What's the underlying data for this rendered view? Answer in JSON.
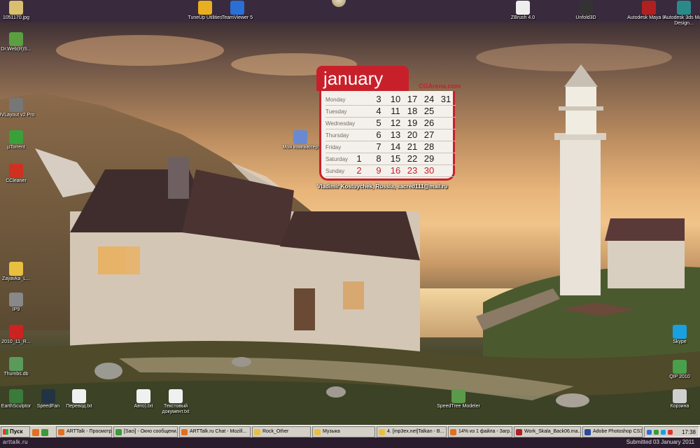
{
  "top_icons": [
    {
      "label": "1051170.jpg",
      "icon": "image-icon",
      "color": "#d8c070"
    },
    {
      "label": "TuneUp Utilities",
      "icon": "tuneup-icon",
      "color": "#e8b020"
    },
    {
      "label": "TeamViewer 5",
      "icon": "teamviewer-icon",
      "color": "#2a6fd6"
    },
    {
      "label": "ZBrush 4.0",
      "icon": "zbrush-icon",
      "color": "#eeeeee"
    },
    {
      "label": "Unfold3D",
      "icon": "unfold3d-icon",
      "color": "#333333"
    },
    {
      "label": "Autodesk Maya 8....",
      "icon": "maya-icon",
      "color": "#b02020"
    },
    {
      "label": "Autodesk 3ds Max Design...",
      "icon": "3dsmax-icon",
      "color": "#2a8a8a"
    }
  ],
  "left_icons": [
    {
      "label": "Dr.Web(R)S...",
      "icon": "drweb-icon",
      "color": "#5aa040"
    },
    {
      "label": "UVLayout v2 Pro",
      "icon": "uvlayout-icon",
      "color": "#777777"
    },
    {
      "label": "µTorrent",
      "icon": "utorrent-icon",
      "color": "#3aa03a"
    },
    {
      "label": "CCleaner",
      "icon": "ccleaner-icon",
      "color": "#d03020"
    },
    {
      "label": "Zayavka_L...",
      "icon": "folder-icon",
      "color": "#e8c040"
    },
    {
      "label": "IP9",
      "icon": "ip9-icon",
      "color": "#888888"
    },
    {
      "label": "2010_11_R...",
      "icon": "pdf-icon",
      "color": "#cc2222"
    },
    {
      "label": "Thumbs.db",
      "icon": "db-file-icon",
      "color": "#5a9a5a"
    }
  ],
  "bottom_icons": [
    {
      "label": "EarthSculptor",
      "icon": "earthsculptor-icon",
      "color": "#3a7a3a"
    },
    {
      "label": "SpeedFan",
      "icon": "speedfan-icon",
      "color": "#223344"
    },
    {
      "label": "Перевод.txt",
      "icon": "txt-file-icon",
      "color": "#f0f0f0"
    },
    {
      "label": "Авто).txt",
      "icon": "txt-file-icon",
      "color": "#f0f0f0"
    },
    {
      "label": "Текстовый документ.txt",
      "icon": "txt-file-icon",
      "color": "#f0f0f0"
    },
    {
      "label": "SpeedTree Modeler",
      "icon": "speedtree-icon",
      "color": "#5a9a4a"
    }
  ],
  "right_icons": [
    {
      "label": "Skype",
      "icon": "skype-icon",
      "color": "#1aa0e0"
    },
    {
      "label": "QIP 2010",
      "icon": "qip-icon",
      "color": "#4aa04a"
    },
    {
      "label": "Корзина",
      "icon": "recycle-bin-icon",
      "color": "#cfcfcf"
    }
  ],
  "center_icon": {
    "label": "Мой компьютер",
    "icon": "my-computer-icon",
    "color": "#6a8ad0"
  },
  "calendar": {
    "month": "january",
    "site": "CGArena.com",
    "author": "Vladimir Kostuychek, Russia, sacred111@mail.ru",
    "rows": [
      {
        "day": "Monday",
        "nums": [
          "",
          "3",
          "10",
          "17",
          "24",
          "31"
        ]
      },
      {
        "day": "Tuesday",
        "nums": [
          "",
          "4",
          "11",
          "18",
          "25",
          ""
        ]
      },
      {
        "day": "Wednesday",
        "nums": [
          "",
          "5",
          "12",
          "19",
          "26",
          ""
        ]
      },
      {
        "day": "Thursday",
        "nums": [
          "",
          "6",
          "13",
          "20",
          "27",
          ""
        ]
      },
      {
        "day": "Friday",
        "nums": [
          "",
          "7",
          "14",
          "21",
          "28",
          ""
        ]
      },
      {
        "day": "Saturday",
        "nums": [
          "1",
          "8",
          "15",
          "22",
          "29",
          ""
        ]
      },
      {
        "day": "Sunday",
        "nums": [
          "2",
          "9",
          "16",
          "23",
          "30",
          ""
        ]
      }
    ]
  },
  "taskbar": {
    "start_label": "Пуск",
    "tasks": [
      {
        "label": "ARTTalk - Просмотр те...",
        "color": "#e07020"
      },
      {
        "label": "[Saci] - Окно сообщени...",
        "color": "#3a9a3a"
      },
      {
        "label": "ARTTalk.ru Chat - Mozill...",
        "color": "#e07020"
      },
      {
        "label": "Rock_Other",
        "color": "#e8c040"
      },
      {
        "label": "Музыка",
        "color": "#e8c040"
      },
      {
        "label": "4. [mp3ex.net]Talkan - B...",
        "color": "#e8c040"
      },
      {
        "label": "14% из 1 файла - Загр...",
        "color": "#e07020"
      },
      {
        "label": "Work_Skala_Back06.ma...",
        "color": "#b02020"
      },
      {
        "label": "Adobe Photoshop CS3 E...",
        "color": "#2a4aa0"
      }
    ],
    "clock": "17:38"
  },
  "footer": {
    "logo": "arttalk.ru",
    "note": "Submitted 03 January 2011"
  }
}
